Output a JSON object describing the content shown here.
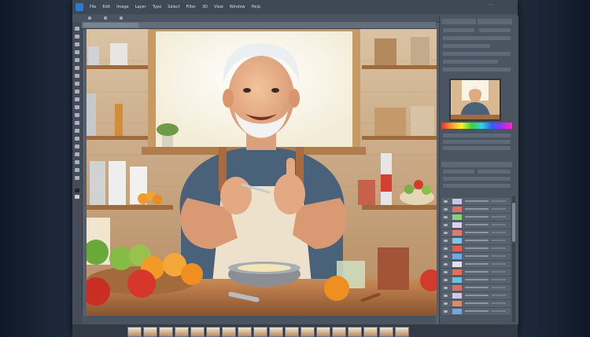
{
  "app": {
    "menu": [
      "File",
      "Edit",
      "Image",
      "Layer",
      "Type",
      "Select",
      "Filter",
      "3D",
      "View",
      "Window",
      "Help"
    ],
    "title_button": "",
    "status_zoom": ""
  },
  "icons": {
    "app_logo": "photoshop-logo-icon",
    "tools": "tool-icon"
  },
  "panels": {
    "navigator_label": "",
    "layers_label": ""
  },
  "colors": {
    "app_bg": "#55606e",
    "menubar": "#3f4855",
    "panel_bg": "#4b5562",
    "page_bg": "#1e2a3c",
    "layer_swatches": [
      "#c9c3e8",
      "#e36f5d",
      "#8fcf74",
      "#d9d1e9",
      "#e27a6f",
      "#7fc7e6",
      "#e55a4f",
      "#6fa7e8",
      "#e2e0ea",
      "#e76d55",
      "#6fc0e0",
      "#d66f60",
      "#cfc8e6",
      "#e7855e",
      "#72a5e4"
    ]
  }
}
